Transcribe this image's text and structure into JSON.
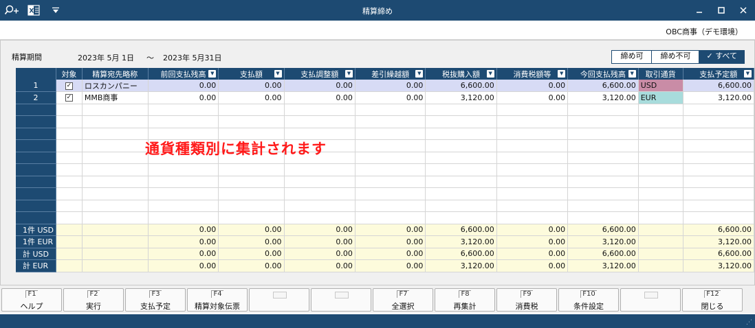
{
  "window": {
    "title": "精算締め"
  },
  "company": "OBC商事（デモ環境）",
  "period": {
    "label": "精算期間",
    "from": "2023年  5月  1日",
    "tilde": "～",
    "to": "2023年  5月31日"
  },
  "filter": {
    "options": [
      "締め可",
      "締め不可",
      "✓ すべて"
    ],
    "selected": "✓ すべて"
  },
  "columns": [
    "対象",
    "精算宛先略称",
    "前回支払残高",
    "支払額",
    "支払調整額",
    "差引繰越額",
    "税抜購入額",
    "消費税額等",
    "今回支払残高",
    "取引通貨",
    "支払予定額"
  ],
  "rows": [
    {
      "no": "1",
      "checked": "✓",
      "name": "ロスカンパニー",
      "prev": "0.00",
      "pay": "0.00",
      "adj": "0.00",
      "carry": "0.00",
      "purchase": "6,600.00",
      "tax": "0.00",
      "current": "6,600.00",
      "currency": "USD",
      "planned": "6,600.00"
    },
    {
      "no": "2",
      "checked": "✓",
      "name": "MMB商事",
      "prev": "0.00",
      "pay": "0.00",
      "adj": "0.00",
      "carry": "0.00",
      "purchase": "3,120.00",
      "tax": "0.00",
      "current": "3,120.00",
      "currency": "EUR",
      "planned": "3,120.00"
    }
  ],
  "summary": [
    {
      "label": "1件   USD",
      "prev": "0.00",
      "pay": "0.00",
      "adj": "0.00",
      "carry": "0.00",
      "purchase": "6,600.00",
      "tax": "0.00",
      "current": "6,600.00",
      "planned": "6,600.00"
    },
    {
      "label": "1件   EUR",
      "prev": "0.00",
      "pay": "0.00",
      "adj": "0.00",
      "carry": "0.00",
      "purchase": "3,120.00",
      "tax": "0.00",
      "current": "3,120.00",
      "planned": "3,120.00"
    },
    {
      "label": "  計   USD",
      "prev": "0.00",
      "pay": "0.00",
      "adj": "0.00",
      "carry": "0.00",
      "purchase": "6,600.00",
      "tax": "0.00",
      "current": "6,600.00",
      "planned": "6,600.00"
    },
    {
      "label": "  計   EUR",
      "prev": "0.00",
      "pay": "0.00",
      "adj": "0.00",
      "carry": "0.00",
      "purchase": "3,120.00",
      "tax": "0.00",
      "current": "3,120.00",
      "planned": "3,120.00"
    }
  ],
  "annotation": "通貨種類別に集計されます",
  "fkeys": [
    {
      "num": "F1",
      "label": "ヘルプ"
    },
    {
      "num": "F2",
      "label": "実行"
    },
    {
      "num": "F3",
      "label": "支払予定"
    },
    {
      "num": "F4",
      "label": "精算対象伝票"
    },
    {
      "num": "",
      "label": ""
    },
    {
      "num": "",
      "label": ""
    },
    {
      "num": "F7",
      "label": "全選択"
    },
    {
      "num": "F8",
      "label": "再集計"
    },
    {
      "num": "F9",
      "label": "消費税"
    },
    {
      "num": "F10",
      "label": "条件設定"
    },
    {
      "num": "",
      "label": ""
    },
    {
      "num": "F12",
      "label": "閉じる"
    }
  ],
  "colors": {
    "header": "#1d4a72",
    "usd": "#c98ca6",
    "eur": "#a8dcdc",
    "summary": "#fdfbdc",
    "annotation": "#ff1a1a"
  },
  "icons": [
    "search-add-icon",
    "excel-icon",
    "dropdown-icon",
    "minimize-icon",
    "maximize-icon",
    "close-icon",
    "column-dropdown-icon",
    "checkbox-icon"
  ]
}
